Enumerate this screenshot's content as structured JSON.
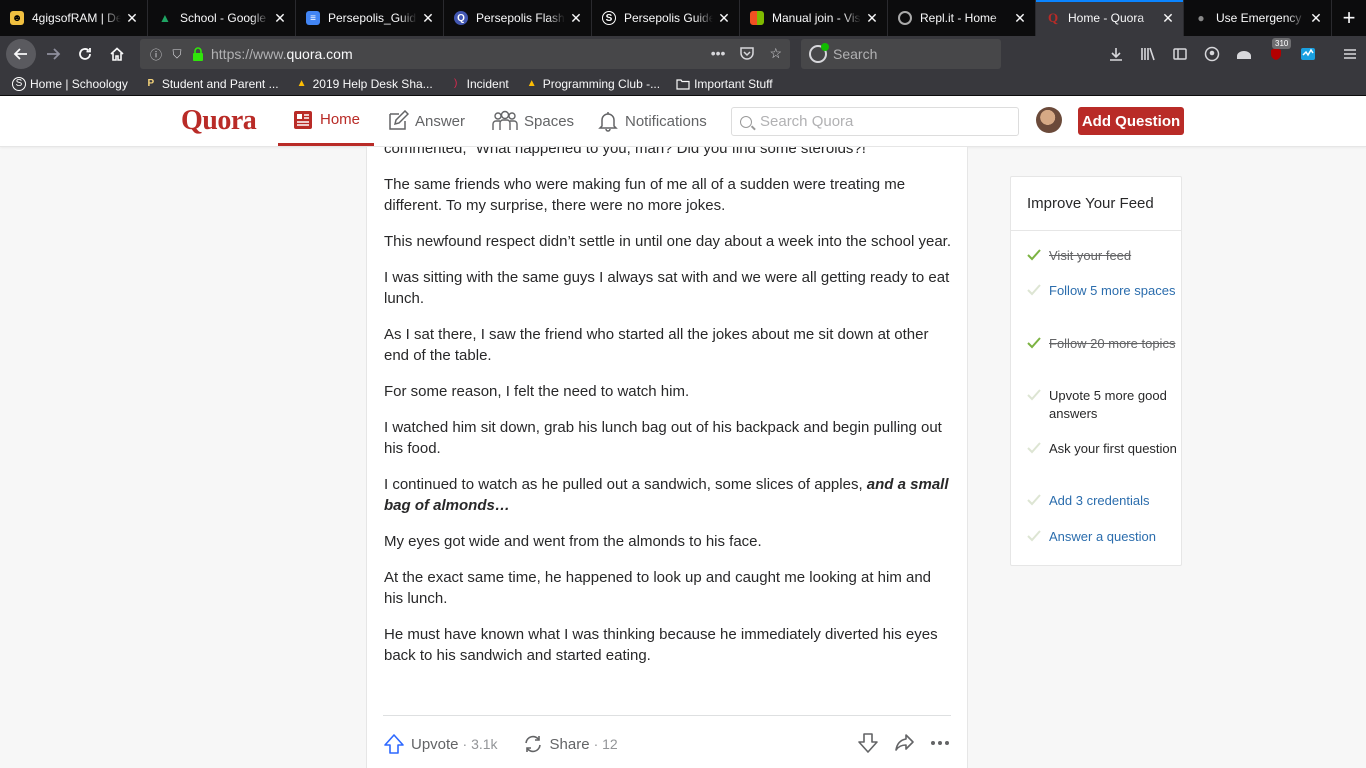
{
  "browser": {
    "tabs": [
      {
        "title": "4gigsofRAM | De",
        "icon": "discord-like-icon",
        "color": "#f0c040",
        "glyph": "☻"
      },
      {
        "title": "School - Google",
        "icon": "google-drive-icon",
        "color": "#1fa463",
        "glyph": "▲"
      },
      {
        "title": "Persepolis_Guide",
        "icon": "google-docs-icon",
        "color": "#4285f4",
        "glyph": "≡"
      },
      {
        "title": "Persepolis Flash",
        "icon": "quizlet-icon",
        "color": "#4257b2",
        "glyph": "Q"
      },
      {
        "title": "Persepolis Guide",
        "icon": "schoology-icon",
        "color": "#0c0c0d",
        "glyph": "S"
      },
      {
        "title": "Manual join - Vis",
        "icon": "microsoft-icon",
        "color": "#f25022",
        "glyph": "■"
      },
      {
        "title": "Repl.it - Home",
        "icon": "replit-icon",
        "color": "#555",
        "glyph": "◎"
      },
      {
        "title": "Home - Quora",
        "icon": "quora-icon",
        "color": "#b92b27",
        "glyph": "Q",
        "active": true
      },
      {
        "title": "Use Emergency",
        "icon": "apple-icon",
        "color": "#444",
        "glyph": "●"
      }
    ],
    "new_tab": "+",
    "url_prefix": "https://www.",
    "url_host": "quora.com",
    "url_more": "•••",
    "search_placeholder": "Search",
    "notification_badge": "310",
    "bookmarks": [
      {
        "label": "Home | Schoology",
        "icon": "schoology-icon"
      },
      {
        "label": "Student and Parent ...",
        "icon": "powerschool-icon"
      },
      {
        "label": "2019 Help Desk Sha...",
        "icon": "google-drive-icon"
      },
      {
        "label": "Incident",
        "icon": "incident-icon"
      },
      {
        "label": "Programming Club -...",
        "icon": "google-drive-icon"
      },
      {
        "label": "Important Stuff",
        "icon": "folder-icon"
      }
    ]
  },
  "quora": {
    "logo": "Quora",
    "nav": {
      "home": "Home",
      "answer": "Answer",
      "spaces": "Spaces",
      "notifications": "Notifications"
    },
    "search_placeholder": "Search Quora",
    "add_question": "Add Question",
    "brand_color": "#b92b27"
  },
  "answer": {
    "paragraphs": [
      "commented, “What happened to you, man? Did you find some steroids?!”",
      "The same friends who were making fun of me all of a sudden were treating me different. To my surprise, there were no more jokes.",
      "This newfound respect didn’t settle in until one day about a week into the school year.",
      "I was sitting with the same guys I always sat with and we were all getting ready to eat lunch.",
      "As I sat there, I saw the friend who started all the jokes about me sit down at other end of the table.",
      "For some reason, I felt the need to watch him.",
      "I watched him sit down, grab his lunch bag out of his backpack and begin pulling out his food."
    ],
    "p8_plain": "I continued to watch as he pulled out a sandwich, some slices of apples, ",
    "p8_emph": "and a small bag of almonds…",
    "paragraphs_after": [
      "My eyes got wide and went from the almonds to his face.",
      "At the exact same time, he happened to look up and caught me looking at him and his lunch.",
      "He must have known what I was thinking because he immediately diverted his eyes back to his sandwich and started eating."
    ],
    "upvote_label": "Upvote",
    "upvote_count": "· 3.1k",
    "share_label": "Share",
    "share_count": "· 12"
  },
  "feed": {
    "title": "Improve Your Feed",
    "items": [
      {
        "label": "Visit your feed",
        "state": "done"
      },
      {
        "label": "Follow 5 more spaces",
        "state": "link"
      },
      {
        "label": "Follow 20 more topics",
        "state": "done"
      },
      {
        "label": "Upvote 5 more good answers",
        "state": "plain"
      },
      {
        "label": "Ask your first question",
        "state": "plain"
      },
      {
        "label": "Add 3 credentials",
        "state": "link"
      },
      {
        "label": "Answer a question",
        "state": "link"
      }
    ]
  }
}
